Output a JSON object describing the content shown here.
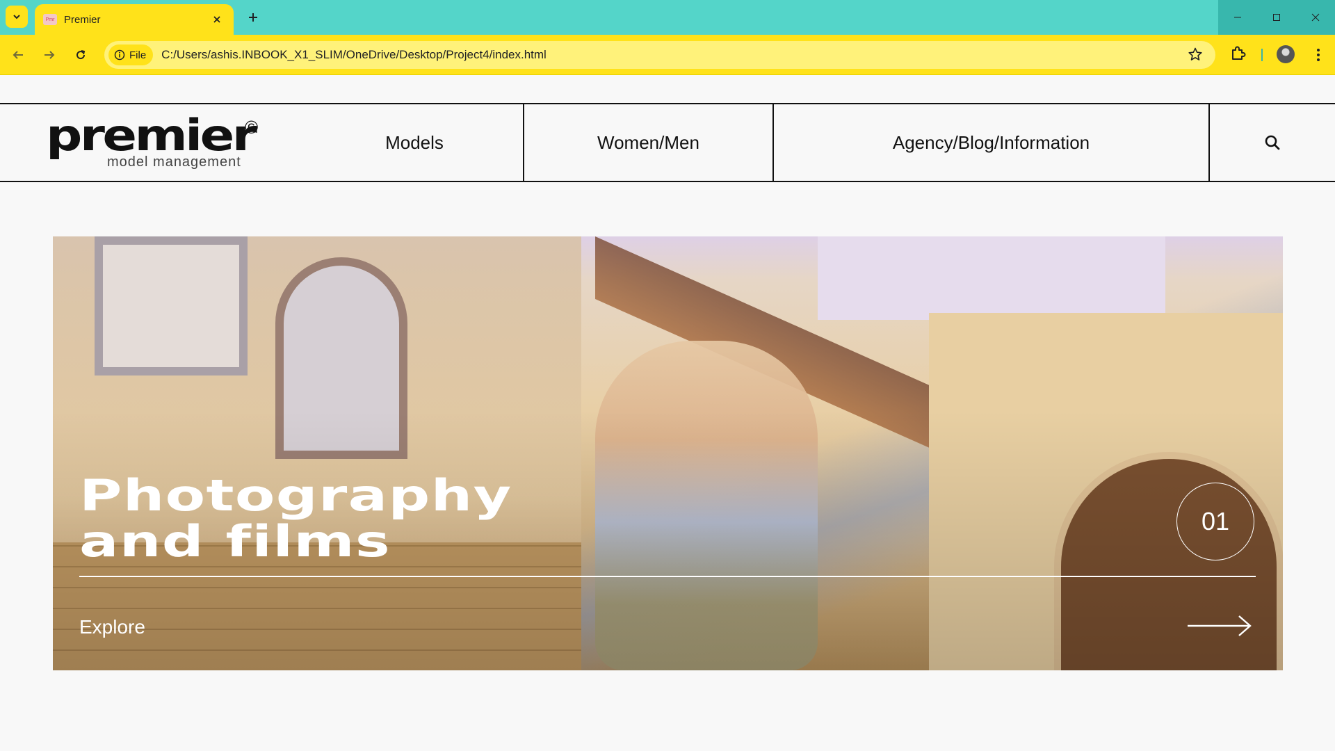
{
  "browser": {
    "tab_title": "Premier",
    "tab_favicon_text": "Pmr",
    "site_chip": "File",
    "url": "C:/Users/ashis.INBOOK_X1_SLIM/OneDrive/Desktop/Project4/index.html",
    "colors": {
      "tabbar": "#54d5c9",
      "toolbar": "#ffe21a",
      "omnibox": "#fff27a"
    }
  },
  "header": {
    "logo": {
      "wordmark": "premier",
      "copyright": "©",
      "subtitle": "model management"
    },
    "nav": [
      "Models",
      "Women/Men",
      "Agency/Blog/Information"
    ],
    "search_icon": "search-icon"
  },
  "hero": {
    "title_line1": "Photography",
    "title_line2": "and films",
    "counter": "01",
    "cta": "Explore",
    "arrow_icon": "long-arrow-right-icon"
  }
}
